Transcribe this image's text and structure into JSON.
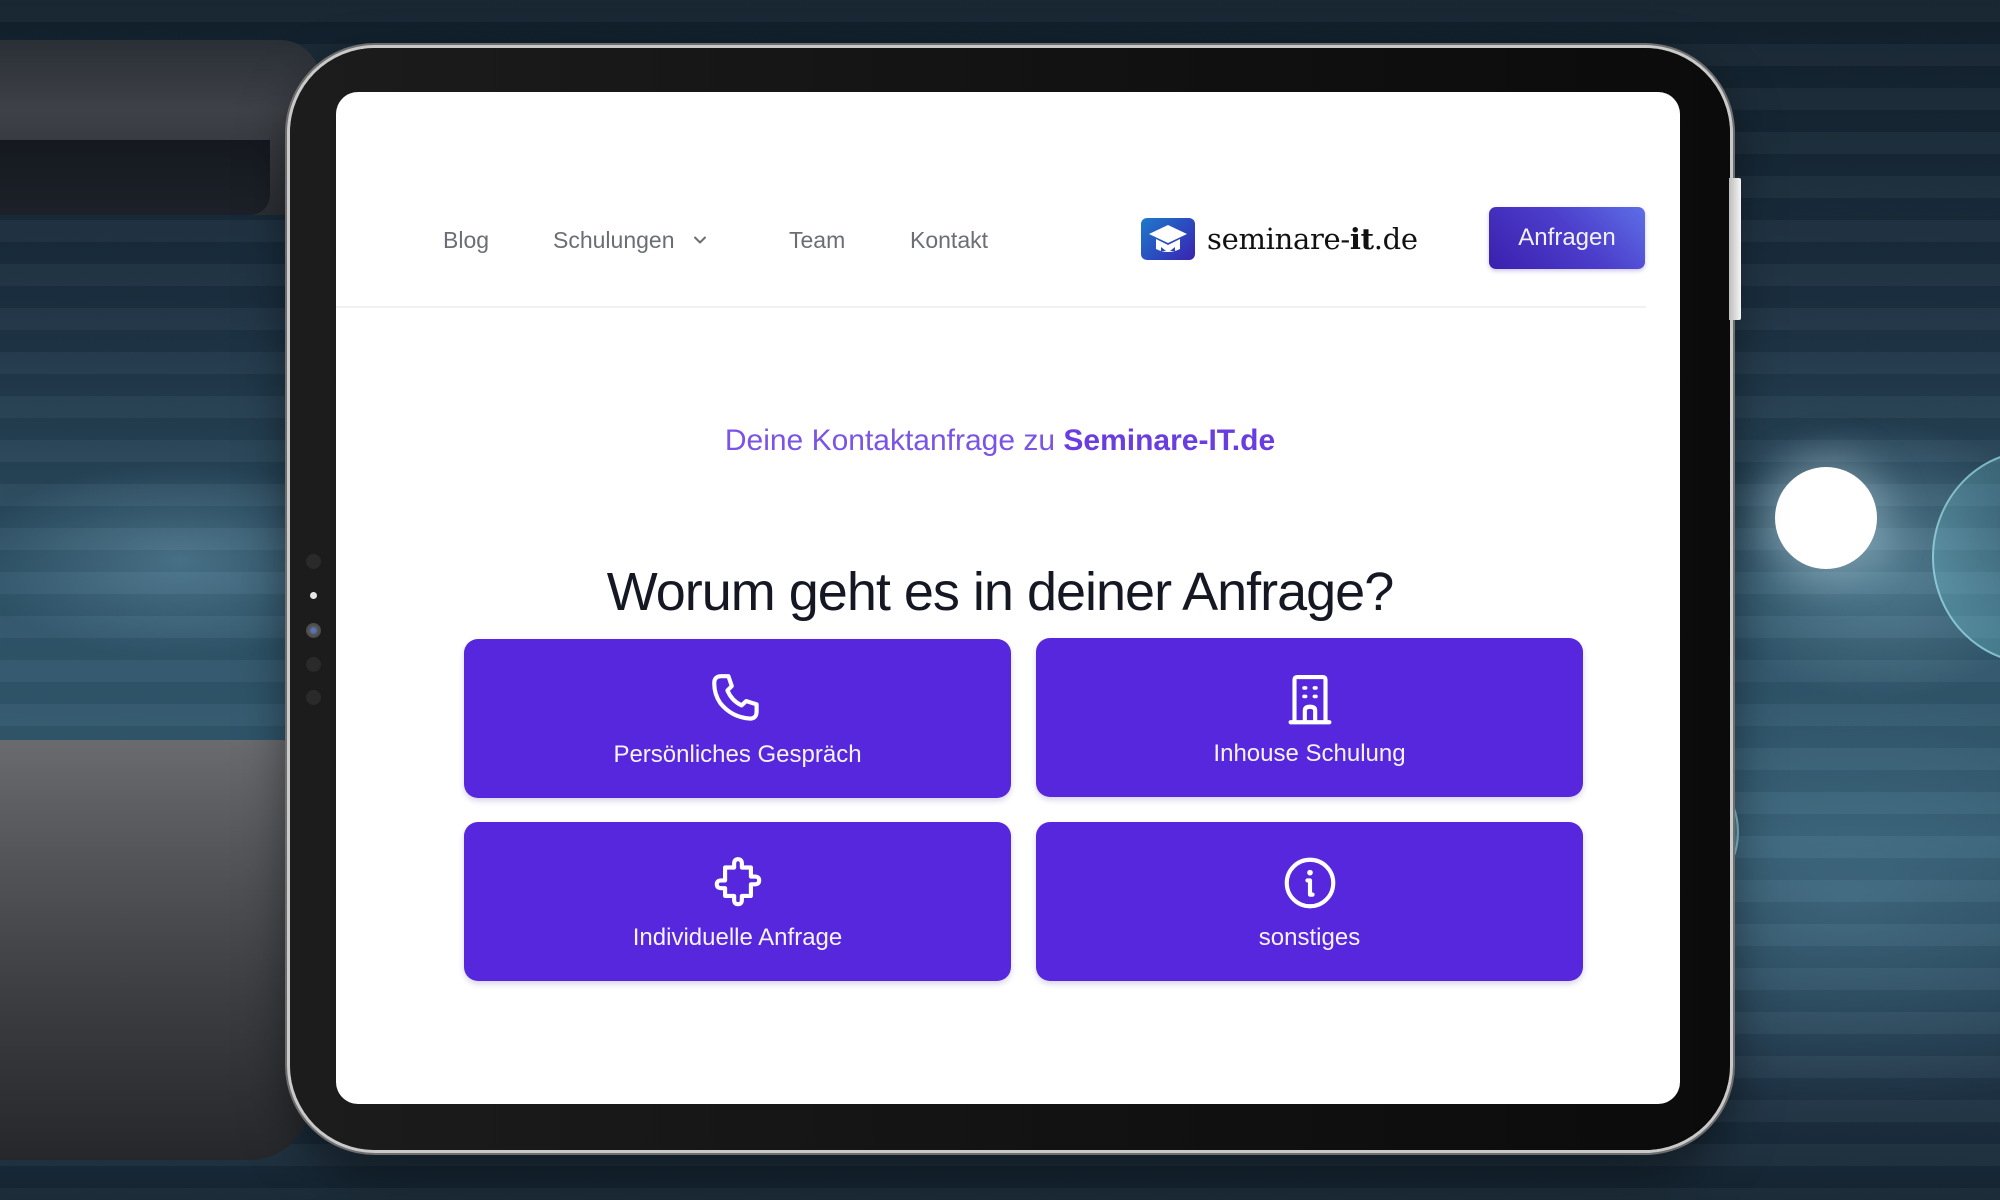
{
  "nav": {
    "items": [
      {
        "label": "Blog"
      },
      {
        "label": "Schulungen",
        "has_dropdown": true,
        "icon": "chevron-down-icon"
      },
      {
        "label": "Team"
      },
      {
        "label": "Kontakt"
      }
    ],
    "logo": {
      "icon": "graduation-cap-icon",
      "prefix": "seminare-",
      "bold": "it",
      "suffix": ".de"
    },
    "cta_label": "Anfragen"
  },
  "main": {
    "subheading_prefix": "Deine Kontaktanfrage zu ",
    "subheading_brand": "Seminare-IT.de",
    "heading": "Worum geht es in deiner Anfrage?",
    "options": [
      {
        "label": "Persönliches Gespräch",
        "icon": "phone-icon"
      },
      {
        "label": "Inhouse Schulung",
        "icon": "building-icon"
      },
      {
        "label": "Individuelle Anfrage",
        "icon": "puzzle-icon"
      },
      {
        "label": "sonstiges",
        "icon": "info-icon"
      }
    ]
  },
  "colors": {
    "accent": "#5727de",
    "subheading": "#7a54e6",
    "heading": "#151823",
    "nav_text": "#6b6e75"
  }
}
